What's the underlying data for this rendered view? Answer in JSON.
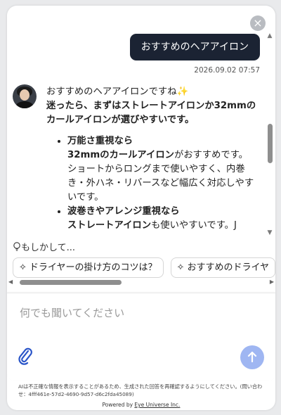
{
  "user_message": "おすすめのヘアアイロン",
  "timestamp": "2026.09.02 07:57",
  "bot": {
    "intro": "おすすめのヘアアイロンですね",
    "intro_emoji": "✨",
    "lead": "迷ったら、まずはストレートアイロンか32mmのカールアイロンが選びやすいです。",
    "bullets": [
      {
        "title": "万能さ重視なら",
        "bold": "32mmのカールアイロン",
        "rest": "がおすすめです。ショートからロングまで使いやすく、内巻き・外ハネ・リバースなど幅広く対応しやすいです。"
      },
      {
        "title": "波巻きやアレンジ重視なら",
        "bold": "ストレートアイロン",
        "rest": "も使いやすいです。J"
      }
    ]
  },
  "suggestions": {
    "label": "もしかして...",
    "chips": [
      "ドライヤーの掛け方のコツは？",
      "おすすめのドライヤ"
    ]
  },
  "input": {
    "placeholder": "何でも聞いてください"
  },
  "icons": {
    "close": "close-icon",
    "attach": "paperclip-icon",
    "send": "arrow-up-icon",
    "bulb": "lightbulb-icon",
    "sparkle": "sparkle-icon"
  },
  "disclaimer": "AIは不正確な情報を表示することがあるため、生成された回答を再確認するようにしてください。(問い合わせ：4fff461e-57d2-4690-9d57-d6c2fda45089)",
  "powered": {
    "prefix": "Powered by ",
    "brand": "Eye Universe Inc."
  },
  "colors": {
    "user_bubble": "#1b2333",
    "send_button": "#9fb6f2",
    "accent_link": "#2a55c8"
  }
}
